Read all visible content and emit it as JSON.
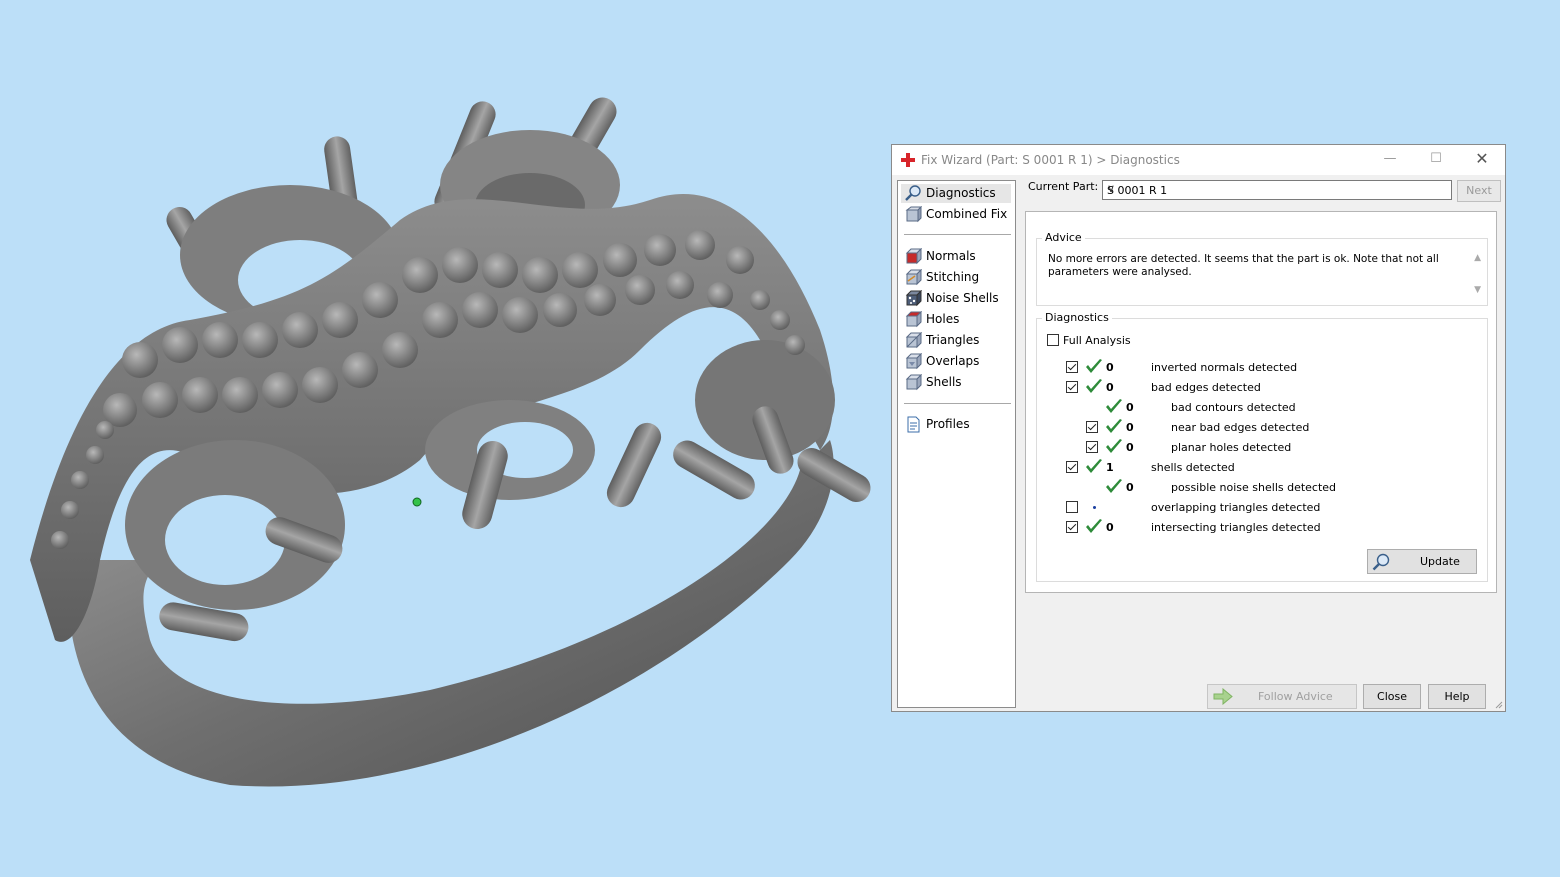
{
  "viewport": {
    "model_name": "ring-model"
  },
  "dialog": {
    "title": "Fix Wizard (Part: S 0001 R 1) > Diagnostics",
    "nav": [
      {
        "label": "Diagnostics",
        "icon": "magnifier-icon",
        "active": true
      },
      {
        "label": "Combined Fix",
        "icon": "combined-fix-icon"
      },
      {
        "label": "Normals",
        "icon": "normals-cube-icon"
      },
      {
        "label": "Stitching",
        "icon": "stitching-cube-icon"
      },
      {
        "label": "Noise Shells",
        "icon": "noise-shells-icon"
      },
      {
        "label": "Holes",
        "icon": "holes-cube-icon"
      },
      {
        "label": "Triangles",
        "icon": "triangles-cube-icon"
      },
      {
        "label": "Overlaps",
        "icon": "overlaps-cube-icon"
      },
      {
        "label": "Shells",
        "icon": "shells-cube-icon"
      },
      {
        "label": "Profiles",
        "icon": "profiles-document-icon"
      }
    ],
    "current_part_label": "Current Part:",
    "current_part_value": "S 0001 R 1",
    "next_label": "Next",
    "advice_title": "Advice",
    "advice_text": "No more errors are detected. It seems that the part is ok. Note that not all parameters were analysed.",
    "diagnostics_title": "Diagnostics",
    "full_analysis_label": "Full Analysis",
    "rows": [
      {
        "label": "inverted normals detected",
        "count": "0",
        "checkbox": true,
        "checked": true,
        "status": "ok",
        "indent": 0
      },
      {
        "label": "bad edges detected",
        "count": "0",
        "checkbox": true,
        "checked": true,
        "status": "ok",
        "indent": 0
      },
      {
        "label": "bad contours detected",
        "count": "0",
        "checkbox": false,
        "checked": false,
        "status": "ok",
        "indent": 1
      },
      {
        "label": "near bad edges detected",
        "count": "0",
        "checkbox": true,
        "checked": true,
        "status": "ok",
        "indent": 1
      },
      {
        "label": "planar holes detected",
        "count": "0",
        "checkbox": true,
        "checked": true,
        "status": "ok",
        "indent": 1
      },
      {
        "label": "shells detected",
        "count": "1",
        "checkbox": true,
        "checked": true,
        "status": "ok",
        "indent": 0
      },
      {
        "label": "possible noise shells detected",
        "count": "0",
        "checkbox": false,
        "checked": false,
        "status": "ok",
        "indent": 1
      },
      {
        "label": "overlapping triangles detected",
        "count": "",
        "checkbox": true,
        "checked": false,
        "status": "dot",
        "indent": 0
      },
      {
        "label": "intersecting triangles detected",
        "count": "0",
        "checkbox": true,
        "checked": true,
        "status": "ok",
        "indent": 0
      }
    ],
    "update_label": "Update",
    "follow_advice_label": "Follow Advice",
    "close_label": "Close",
    "help_label": "Help",
    "colors": {
      "check_green": "#2e8b3a",
      "background": "#bcdff8",
      "model_gray": "#7a7a7a"
    }
  }
}
